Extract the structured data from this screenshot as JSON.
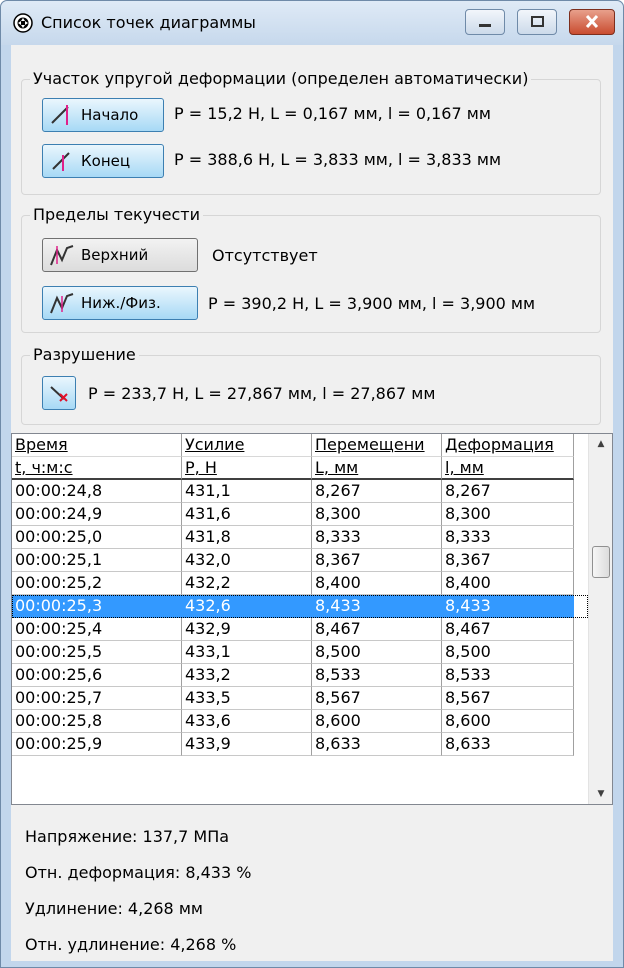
{
  "window": {
    "title": "Список точек диаграммы",
    "icon": "app-icon",
    "controls": {
      "minimize": "minimize-icon",
      "maximize": "maximize-icon",
      "close": "close-icon"
    }
  },
  "elastic": {
    "title": "Участок упругой деформации (определен автоматически)",
    "start_label": "Начало",
    "start_value": "P = 15,2 Н, L = 0,167 мм, l = 0,167 мм",
    "end_label": "Конец",
    "end_value": "P = 388,6 Н, L = 3,833 мм, l = 3,833 мм"
  },
  "yield": {
    "title": "Пределы текучести",
    "upper_label": "Верхний",
    "upper_value": "Отсутствует",
    "lower_label": "Ниж./Физ.",
    "lower_value": "P = 390,2 Н, L = 3,900 мм, l = 3,900 мм"
  },
  "fracture": {
    "title": "Разрушение",
    "value": "P = 233,7 Н, L = 27,867 мм, l = 27,867 мм"
  },
  "table": {
    "headers": [
      "Время",
      "Усилие",
      "Перемещени",
      "Деформация"
    ],
    "units": [
      "t, ч:м:с",
      "P, Н",
      "L, мм",
      "l, мм"
    ],
    "rows": [
      [
        "00:00:24,8",
        "431,1",
        "8,267",
        "8,267"
      ],
      [
        "00:00:24,9",
        "431,6",
        "8,300",
        "8,300"
      ],
      [
        "00:00:25,0",
        "431,8",
        "8,333",
        "8,333"
      ],
      [
        "00:00:25,1",
        "432,0",
        "8,367",
        "8,367"
      ],
      [
        "00:00:25,2",
        "432,2",
        "8,400",
        "8,400"
      ],
      [
        "00:00:25,3",
        "432,6",
        "8,433",
        "8,433"
      ],
      [
        "00:00:25,4",
        "432,9",
        "8,467",
        "8,467"
      ],
      [
        "00:00:25,5",
        "433,1",
        "8,500",
        "8,500"
      ],
      [
        "00:00:25,6",
        "433,2",
        "8,533",
        "8,533"
      ],
      [
        "00:00:25,7",
        "433,5",
        "8,567",
        "8,567"
      ],
      [
        "00:00:25,8",
        "433,6",
        "8,600",
        "8,600"
      ],
      [
        "00:00:25,9",
        "433,9",
        "8,633",
        "8,633"
      ]
    ],
    "selected_index": 5,
    "selection_color": "#3399ff"
  },
  "stats": {
    "stress": "Напряжение: 137,7 МПа",
    "rel_deformation": "Отн. деформация: 8,433 %",
    "elongation": "Удлинение: 4,268 мм",
    "rel_elongation": "Отн. удлинение: 4,268 %"
  }
}
